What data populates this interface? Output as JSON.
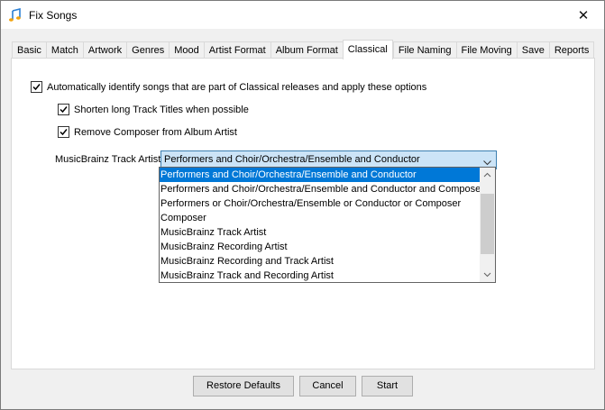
{
  "window": {
    "title": "Fix Songs",
    "close_glyph": "✕",
    "icon": "music-note-icon"
  },
  "tabs": [
    {
      "label": "Basic"
    },
    {
      "label": "Match"
    },
    {
      "label": "Artwork"
    },
    {
      "label": "Genres"
    },
    {
      "label": "Mood"
    },
    {
      "label": "Artist Format"
    },
    {
      "label": "Album Format"
    },
    {
      "label": "Classical",
      "active": true
    },
    {
      "label": "File Naming"
    },
    {
      "label": "File Moving"
    },
    {
      "label": "Save"
    },
    {
      "label": "Reports"
    }
  ],
  "classical": {
    "auto_identify": {
      "label": "Automatically identify songs that are part of Classical releases and apply these options",
      "checked": true
    },
    "shorten_titles": {
      "label": "Shorten long Track Titles when possible",
      "checked": true
    },
    "remove_composer": {
      "label": "Remove Composer from Album Artist",
      "checked": true
    },
    "track_artist": {
      "label": "MusicBrainz Track Artist:",
      "selected": "Performers and Choir/Orchestra/Ensemble and Conductor",
      "options": [
        "Performers and Choir/Orchestra/Ensemble and Conductor",
        "Performers and Choir/Orchestra/Ensemble and Conductor and Composer",
        "Performers or Choir/Orchestra/Ensemble or Conductor or Composer",
        "Composer",
        "MusicBrainz Track Artist",
        "MusicBrainz Recording Artist",
        "MusicBrainz Recording and Track Artist",
        "MusicBrainz Track and Recording Artist"
      ]
    }
  },
  "buttons": {
    "restore": "Restore Defaults",
    "cancel": "Cancel",
    "start": "Start"
  },
  "colors": {
    "selection": "#0078d7",
    "combo_focus": "#cce4f7",
    "title_bar": "#ffffff",
    "dialog_bg": "#f0f0f0"
  }
}
